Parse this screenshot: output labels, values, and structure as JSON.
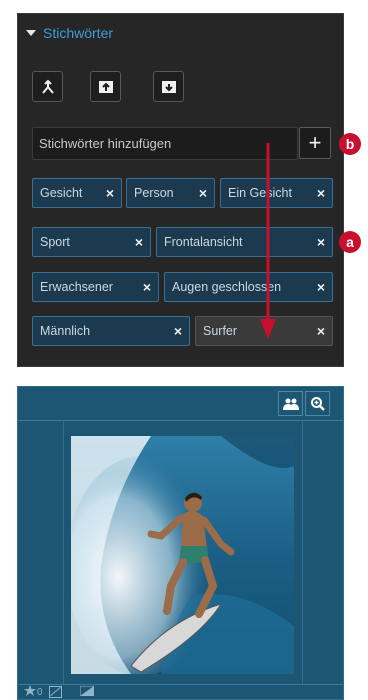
{
  "keywords_panel": {
    "title": "Stichwörter",
    "input_placeholder": "Stichwörter hinzufügen",
    "add_label": "+",
    "chips": [
      {
        "label": "Gesicht",
        "close": "×"
      },
      {
        "label": "Person",
        "close": "×"
      },
      {
        "label": "Ein Gesicht",
        "close": "×"
      },
      {
        "label": "Sport",
        "close": "×"
      },
      {
        "label": "Frontalansicht",
        "close": "×"
      },
      {
        "label": "Erwachsener",
        "close": "×"
      },
      {
        "label": "Augen geschlossen",
        "close": "×"
      },
      {
        "label": "Männlich",
        "close": "×"
      },
      {
        "label": "Surfer",
        "close": "×"
      }
    ],
    "toolbar_icons": [
      "merge-icon",
      "import-icon",
      "export-icon"
    ]
  },
  "callouts": {
    "a": "a",
    "b": "b"
  },
  "image_panel": {
    "icons": [
      "people-icon",
      "zoom-icon"
    ],
    "footer_count": "0"
  },
  "colors": {
    "panel_bg": "#262626",
    "accent": "#3d9fd6",
    "chip_bg": "#1c3a4f",
    "callout": "#c8102e",
    "preview_bg": "#1d5673"
  }
}
